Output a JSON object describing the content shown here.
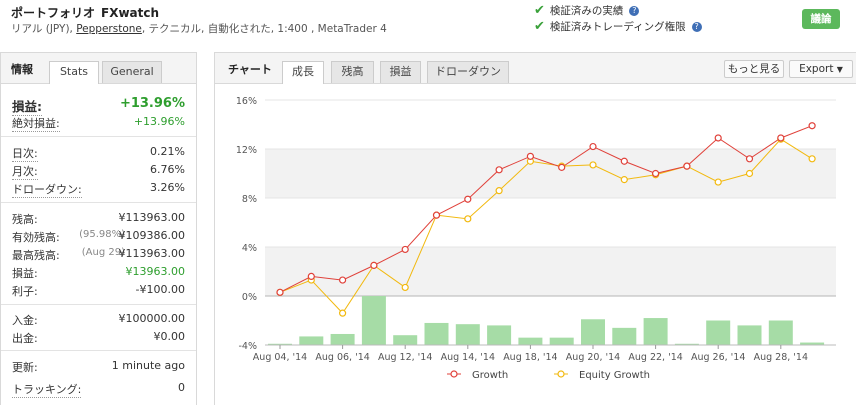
{
  "header": {
    "title": "ポートフォリオ",
    "account_name": "FXwatch",
    "sub_prefix": "リアル (JPY),",
    "broker": "Pepperstone",
    "sub_suffix": ", テクニカル, 自動化された, 1:400 , MetaTrader 4",
    "verified_track": "検証済みの実績",
    "verified_trading": "検証済みトレーディング権限",
    "discuss_button": "議論"
  },
  "left_panel": {
    "tab_info": "情報",
    "tab_stats": "Stats",
    "tab_general": "General",
    "gain_label": "損益:",
    "gain_value": "+13.96%",
    "abs_gain_label": "絶対損益:",
    "abs_gain_value": "+13.96%",
    "daily_label": "日次:",
    "daily_value": "0.21%",
    "monthly_label": "月次:",
    "monthly_value": "6.76%",
    "drawdown_label": "ドローダウン:",
    "drawdown_value": "3.26%",
    "balance_label": "残高:",
    "balance_value": "¥113963.00",
    "equity_label": "有効残高:",
    "equity_pct": "(95.98%)",
    "equity_value": "¥109386.00",
    "highest_label": "最高残高:",
    "highest_date": "(Aug 29)",
    "highest_value": "¥113963.00",
    "profit_label": "損益:",
    "profit_value": "¥13963.00",
    "interest_label": "利子:",
    "interest_value": "-¥100.00",
    "deposits_label": "入金:",
    "deposits_value": "¥100000.00",
    "withdrawals_label": "出金:",
    "withdrawals_value": "¥0.00",
    "updated_label": "更新:",
    "updated_value": "1 minute ago",
    "tracking_label": "トラッキング:",
    "tracking_value": "0"
  },
  "right_panel": {
    "tab_chart": "チャート",
    "tab_growth": "成長",
    "tab_balance": "残高",
    "tab_profit": "損益",
    "tab_drawdown": "ドローダウン",
    "more_button": "もっと見る",
    "export_button": "Export"
  },
  "chart_data": {
    "type": "line",
    "title": "",
    "xlabel": "",
    "ylabel": "",
    "ylim": [
      -4,
      16
    ],
    "y_ticks": [
      "16%",
      "12%",
      "8%",
      "4%",
      "0%",
      "-4%"
    ],
    "x_tick_labels": [
      "Aug 04, '14",
      "Aug 06, '14",
      "Aug 12, '14",
      "Aug 14, '14",
      "Aug 18, '14",
      "Aug 20, '14",
      "Aug 22, '14",
      "Aug 26, '14",
      "Aug 28, '14"
    ],
    "series": [
      {
        "name": "Growth",
        "color": "#e0413a",
        "values": [
          0.3,
          1.6,
          1.3,
          2.5,
          3.8,
          6.6,
          7.9,
          10.3,
          11.4,
          10.5,
          12.2,
          11.0,
          10.0,
          10.6,
          12.9,
          11.2,
          12.9,
          13.9
        ]
      },
      {
        "name": "Equity Growth",
        "color": "#f2b90f",
        "values": [
          0.3,
          1.3,
          -1.4,
          2.5,
          0.7,
          6.6,
          6.3,
          8.6,
          11.0,
          10.6,
          10.7,
          9.5,
          9.9,
          10.6,
          9.3,
          10.0,
          12.8,
          11.2
        ]
      }
    ],
    "bars": {
      "color": "#a6dca6",
      "values": [
        -3.9,
        -3.3,
        -3.1,
        0.0,
        -3.2,
        -2.2,
        -2.3,
        -2.4,
        -3.4,
        -3.4,
        -1.9,
        -2.6,
        -1.8,
        -3.9,
        -2.0,
        -2.4,
        -2.0,
        -3.8
      ]
    }
  }
}
